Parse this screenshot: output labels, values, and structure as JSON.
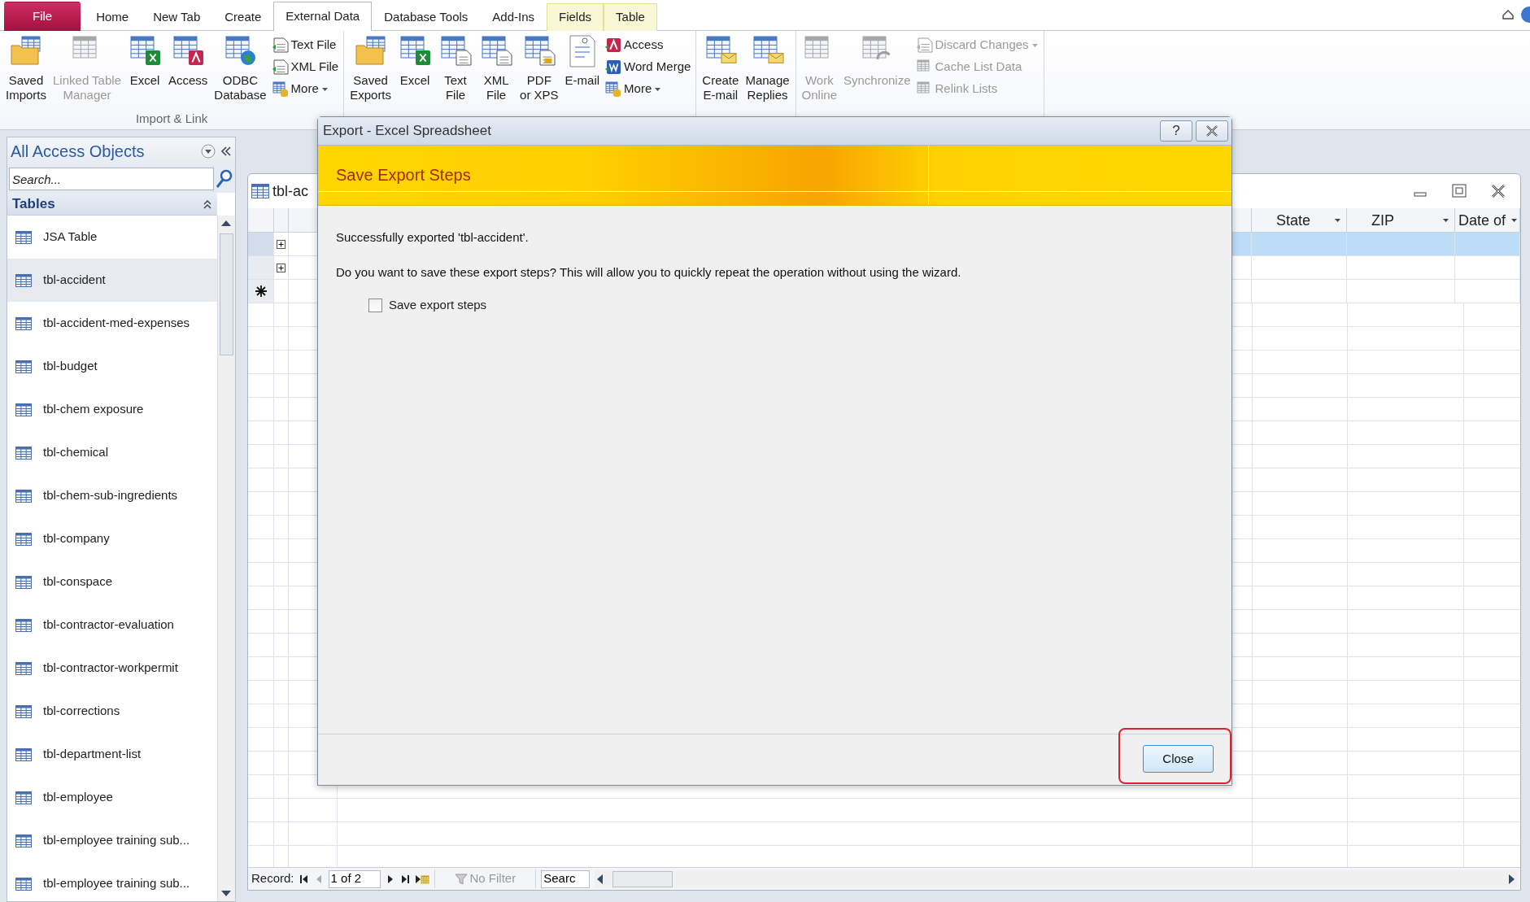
{
  "tabs": [
    {
      "label": "File",
      "kind": "file",
      "selected": false
    },
    {
      "label": "Home",
      "kind": "normal",
      "selected": false
    },
    {
      "label": "New Tab",
      "kind": "normal",
      "selected": false
    },
    {
      "label": "Create",
      "kind": "normal",
      "selected": false
    },
    {
      "label": "External Data",
      "kind": "normal",
      "selected": true
    },
    {
      "label": "Database Tools",
      "kind": "normal",
      "selected": false
    },
    {
      "label": "Add-Ins",
      "kind": "normal",
      "selected": false
    },
    {
      "label": "Fields",
      "kind": "contextual",
      "selected": false
    },
    {
      "label": "Table",
      "kind": "contextual",
      "selected": false
    }
  ],
  "ribbon": {
    "groups": [
      {
        "label": "Import & Link",
        "buttons": [
          {
            "kind": "large",
            "lines": [
              "Saved",
              "Imports"
            ],
            "disabled": false,
            "dropdown": false
          },
          {
            "kind": "large",
            "lines": [
              "Linked Table",
              "Manager"
            ],
            "disabled": true,
            "dropdown": false
          },
          {
            "kind": "large",
            "lines": [
              "Excel"
            ],
            "disabled": false,
            "dropdown": false
          },
          {
            "kind": "large",
            "lines": [
              "Access"
            ],
            "disabled": false,
            "dropdown": false
          },
          {
            "kind": "large",
            "lines": [
              "ODBC",
              "Database"
            ],
            "disabled": false,
            "dropdown": false
          },
          {
            "kind": "small",
            "lines": [
              "Text File"
            ],
            "disabled": false,
            "dropdown": false
          },
          {
            "kind": "small",
            "lines": [
              "XML File"
            ],
            "disabled": false,
            "dropdown": false
          },
          {
            "kind": "small",
            "lines": [
              "More"
            ],
            "disabled": false,
            "dropdown": true
          }
        ]
      },
      {
        "buttons": [
          {
            "kind": "large",
            "lines": [
              "Saved",
              "Exports"
            ],
            "disabled": false,
            "dropdown": false
          },
          {
            "kind": "large",
            "lines": [
              "Excel"
            ],
            "disabled": false,
            "dropdown": false
          },
          {
            "kind": "large",
            "lines": [
              "Text",
              "File"
            ],
            "disabled": false,
            "dropdown": false
          },
          {
            "kind": "large",
            "lines": [
              "XML",
              "File"
            ],
            "disabled": false,
            "dropdown": false
          },
          {
            "kind": "large",
            "lines": [
              "PDF",
              "or XPS"
            ],
            "disabled": false,
            "dropdown": false
          },
          {
            "kind": "large",
            "lines": [
              "E-mail"
            ],
            "disabled": false,
            "dropdown": false
          },
          {
            "kind": "small",
            "lines": [
              "Access"
            ],
            "disabled": false,
            "dropdown": false
          },
          {
            "kind": "small",
            "lines": [
              "Word Merge"
            ],
            "disabled": false,
            "dropdown": false
          },
          {
            "kind": "small",
            "lines": [
              "More"
            ],
            "disabled": false,
            "dropdown": true
          }
        ]
      },
      {
        "buttons": [
          {
            "kind": "large",
            "lines": [
              "Create",
              "E-mail"
            ],
            "disabled": false,
            "dropdown": false
          },
          {
            "kind": "large",
            "lines": [
              "Manage",
              "Replies"
            ],
            "disabled": false,
            "dropdown": false
          }
        ]
      },
      {
        "buttons": [
          {
            "kind": "large",
            "lines": [
              "Work",
              "Online"
            ],
            "disabled": true,
            "dropdown": false
          },
          {
            "kind": "large",
            "lines": [
              "Synchronize"
            ],
            "disabled": true,
            "dropdown": false
          },
          {
            "kind": "small",
            "lines": [
              "Discard Changes"
            ],
            "disabled": true,
            "dropdown": true
          },
          {
            "kind": "small",
            "lines": [
              "Cache List Data"
            ],
            "disabled": true,
            "dropdown": false
          },
          {
            "kind": "small",
            "lines": [
              "Relink Lists"
            ],
            "disabled": true,
            "dropdown": false
          }
        ]
      }
    ]
  },
  "navigation_pane": {
    "title": "All Access Objects",
    "search": {
      "placeholder": "Search..."
    },
    "section": "Tables",
    "items": [
      {
        "label": "JSA Table",
        "selected": false
      },
      {
        "label": "tbl-accident",
        "selected": true
      },
      {
        "label": "tbl-accident-med-expenses",
        "selected": false
      },
      {
        "label": "tbl-budget",
        "selected": false
      },
      {
        "label": "tbl-chem exposure",
        "selected": false
      },
      {
        "label": "tbl-chemical",
        "selected": false
      },
      {
        "label": "tbl-chem-sub-ingredients",
        "selected": false
      },
      {
        "label": "tbl-company",
        "selected": false
      },
      {
        "label": "tbl-conspace",
        "selected": false
      },
      {
        "label": "tbl-contractor-evaluation",
        "selected": false
      },
      {
        "label": "tbl-contractor-workpermit",
        "selected": false
      },
      {
        "label": "tbl-corrections",
        "selected": false
      },
      {
        "label": "tbl-department-list",
        "selected": false
      },
      {
        "label": "tbl-employee",
        "selected": false
      },
      {
        "label": "tbl-employee training sub...",
        "selected": false
      },
      {
        "label": "tbl-employee training sub...",
        "selected": false
      }
    ]
  },
  "document": {
    "tab_title": "tbl-ac",
    "columns": [
      {
        "label": "State"
      },
      {
        "label": "ZIP"
      },
      {
        "label": "Date of"
      }
    ],
    "rows": [
      {
        "kind": "record",
        "selected": true,
        "expanded": false
      },
      {
        "kind": "record",
        "selected": false,
        "expanded": false
      },
      {
        "kind": "new",
        "selected": false
      }
    ],
    "record_nav": {
      "label": "Record:",
      "position": "1 of 2",
      "filter": "No Filter",
      "search": "Searc"
    }
  },
  "dialog": {
    "title": "Export - Excel Spreadsheet",
    "help_button": "?",
    "heading": "Save Export Steps",
    "message": "Successfully exported 'tbl-accident'.",
    "question": "Do you want to save these export steps? This will allow you to quickly repeat the operation without using the wizard.",
    "checkbox": {
      "label": "Save export steps",
      "checked": false
    },
    "close_button": {
      "label": "Close",
      "highlighted": true
    }
  }
}
